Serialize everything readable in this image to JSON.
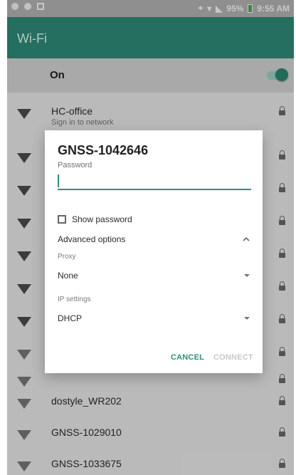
{
  "statusbar": {
    "battery": "95%",
    "time": "9:55 AM"
  },
  "appbar": {
    "title": "Wi-Fi"
  },
  "wifi_toggle": {
    "label": "On",
    "enabled": true
  },
  "networks": [
    {
      "name": "HC-office",
      "subtitle": "Sign in to network"
    },
    {
      "name": "",
      "subtitle": ""
    },
    {
      "name": "",
      "subtitle": ""
    },
    {
      "name": "",
      "subtitle": ""
    },
    {
      "name": "",
      "subtitle": ""
    },
    {
      "name": "",
      "subtitle": ""
    },
    {
      "name": "",
      "subtitle": ""
    },
    {
      "name": "",
      "subtitle": ""
    },
    {
      "name": "",
      "subtitle": ""
    },
    {
      "name": "dostyle_WR202",
      "subtitle": ""
    },
    {
      "name": "GNSS-1029010",
      "subtitle": ""
    },
    {
      "name": "GNSS-1033675",
      "subtitle": ""
    }
  ],
  "dialog": {
    "title": "GNSS-1042646",
    "password_label": "Password",
    "show_password_label": "Show password",
    "advanced_options_label": "Advanced options",
    "proxy_label": "Proxy",
    "proxy_value": "None",
    "ip_settings_label": "IP settings",
    "ip_settings_value": "DHCP",
    "cancel_label": "CANCEL",
    "connect_label": "CONNECT"
  },
  "colors": {
    "accent": "#2f8f7a",
    "statusbar": "#b8b8b8",
    "background": "#efefef",
    "disabled_text": "#c8c8c8"
  },
  "icons": {
    "wifi": "wifi-signal-icon",
    "lock": "lock-icon",
    "dropdown": "chevron-down-icon",
    "advanced": "chevron-up-icon"
  }
}
